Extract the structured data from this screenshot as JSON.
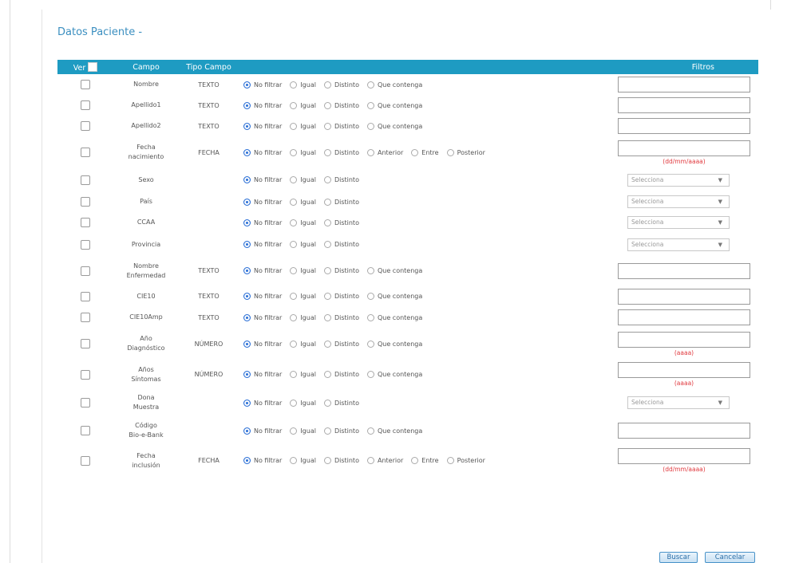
{
  "section": {
    "title": "Datos Paciente -"
  },
  "table": {
    "headers": {
      "ver": "Ver",
      "campo": "Campo",
      "tipo": "Tipo Campo",
      "filtros": "Filtros"
    },
    "rows": [
      {
        "campo": [
          "Nombre"
        ],
        "tipo": "TEXTO",
        "options": [
          "No filtrar",
          "Igual",
          "Distinto",
          "Que contenga"
        ],
        "filter": "text",
        "hint": "",
        "placeholder": ""
      },
      {
        "campo": [
          "Apellido1"
        ],
        "tipo": "TEXTO",
        "options": [
          "No filtrar",
          "Igual",
          "Distinto",
          "Que contenga"
        ],
        "filter": "text",
        "hint": "",
        "placeholder": ""
      },
      {
        "campo": [
          "Apellido2"
        ],
        "tipo": "TEXTO",
        "options": [
          "No filtrar",
          "Igual",
          "Distinto",
          "Que contenga"
        ],
        "filter": "text",
        "hint": "",
        "placeholder": ""
      },
      {
        "campo": [
          "Fecha",
          "nacimiento"
        ],
        "tipo": "FECHA",
        "options": [
          "No filtrar",
          "Igual",
          "Distinto",
          "Anterior",
          "Entre",
          "Posterior"
        ],
        "filter": "text",
        "hint": "(dd/mm/aaaa)",
        "placeholder": ""
      },
      {
        "campo": [
          "Sexo"
        ],
        "tipo": "",
        "options": [
          "No filtrar",
          "Igual",
          "Distinto"
        ],
        "filter": "select",
        "hint": "",
        "placeholder": "Selecciona"
      },
      {
        "campo": [
          "País"
        ],
        "tipo": "",
        "options": [
          "No filtrar",
          "Igual",
          "Distinto"
        ],
        "filter": "select",
        "hint": "",
        "placeholder": "Selecciona"
      },
      {
        "campo": [
          "CCAA"
        ],
        "tipo": "",
        "options": [
          "No filtrar",
          "Igual",
          "Distinto"
        ],
        "filter": "select",
        "hint": "",
        "placeholder": "Selecciona"
      },
      {
        "campo": [
          "Provincia"
        ],
        "tipo": "",
        "options": [
          "No filtrar",
          "Igual",
          "Distinto"
        ],
        "filter": "select",
        "hint": "",
        "placeholder": "Selecciona"
      },
      {
        "campo": [
          "Nombre",
          "Enfermedad"
        ],
        "tipo": "TEXTO",
        "options": [
          "No filtrar",
          "Igual",
          "Distinto",
          "Que contenga"
        ],
        "filter": "text",
        "hint": "",
        "placeholder": ""
      },
      {
        "campo": [
          "CIE10"
        ],
        "tipo": "TEXTO",
        "options": [
          "No filtrar",
          "Igual",
          "Distinto",
          "Que contenga"
        ],
        "filter": "text",
        "hint": "",
        "placeholder": ""
      },
      {
        "campo": [
          "CIE10Amp"
        ],
        "tipo": "TEXTO",
        "options": [
          "No filtrar",
          "Igual",
          "Distinto",
          "Que contenga"
        ],
        "filter": "text",
        "hint": "",
        "placeholder": ""
      },
      {
        "campo": [
          "Año",
          "Diagnóstico"
        ],
        "tipo": "NÚMERO",
        "options": [
          "No filtrar",
          "Igual",
          "Distinto",
          "Que contenga"
        ],
        "filter": "text",
        "hint": "(aaaa)",
        "placeholder": ""
      },
      {
        "campo": [
          "Años",
          "Síntomas"
        ],
        "tipo": "NÚMERO",
        "options": [
          "No filtrar",
          "Igual",
          "Distinto",
          "Que contenga"
        ],
        "filter": "text",
        "hint": "(aaaa)",
        "placeholder": ""
      },
      {
        "campo": [
          "Dona",
          "Muestra"
        ],
        "tipo": "",
        "options": [
          "No filtrar",
          "Igual",
          "Distinto"
        ],
        "filter": "select",
        "hint": "",
        "placeholder": "Selecciona"
      },
      {
        "campo": [
          "Código",
          "Bio-e-Bank"
        ],
        "tipo": "",
        "options": [
          "No filtrar",
          "Igual",
          "Distinto",
          "Que contenga"
        ],
        "filter": "text",
        "hint": "",
        "placeholder": ""
      },
      {
        "campo": [
          "Fecha",
          "inclusión"
        ],
        "tipo": "FECHA",
        "options": [
          "No filtrar",
          "Igual",
          "Distinto",
          "Anterior",
          "Entre",
          "Posterior"
        ],
        "filter": "text",
        "hint": "(dd/mm/aaaa)",
        "placeholder": ""
      }
    ]
  },
  "buttons": {
    "buscar": "Buscar",
    "cancelar": "Cancelar"
  },
  "icons": {
    "select_chevron": "chevron-down-icon"
  }
}
